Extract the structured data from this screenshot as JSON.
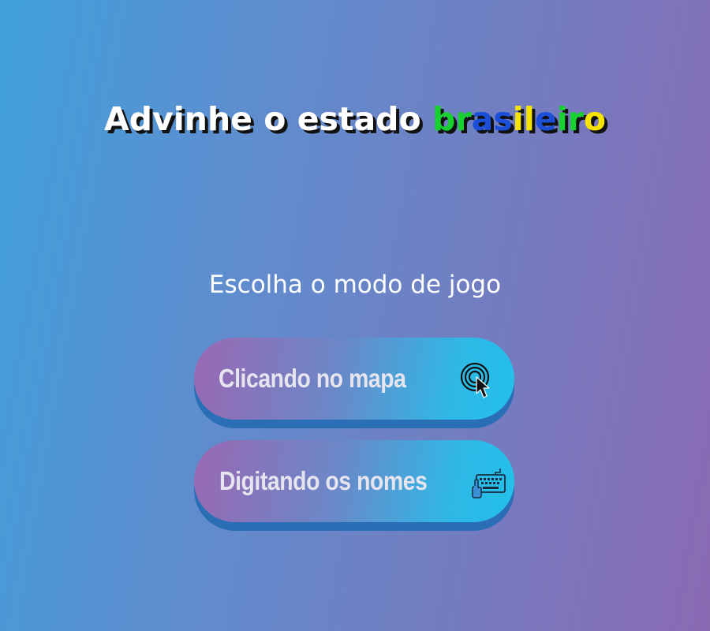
{
  "title": {
    "prefix": "Advinhe o estado ",
    "highlight_letters": [
      {
        "char": "b",
        "color": "#18d030"
      },
      {
        "char": "r",
        "color": "#18d030"
      },
      {
        "char": "a",
        "color": "#1c4fd8"
      },
      {
        "char": "s",
        "color": "#1c4fd8"
      },
      {
        "char": "i",
        "color": "#f4e400"
      },
      {
        "char": "l",
        "color": "#f4e400"
      },
      {
        "char": "e",
        "color": "#1c4fd8"
      },
      {
        "char": "i",
        "color": "#18d030"
      },
      {
        "char": "r",
        "color": "#18d030"
      },
      {
        "char": "o",
        "color": "#f4e400"
      }
    ]
  },
  "subtitle": "Escolha o modo de jogo",
  "modes": [
    {
      "label": "Clicando no mapa",
      "icon": "click-cursor-icon"
    },
    {
      "label": "Digitando os nomes",
      "icon": "keyboard-icon"
    }
  ],
  "colors": {
    "background_start": "#3ea0da",
    "background_end": "#8a6ab3",
    "button_start": "#9a68b3",
    "button_end": "#22c0ea",
    "button_shadow": "#2a6fb6"
  }
}
